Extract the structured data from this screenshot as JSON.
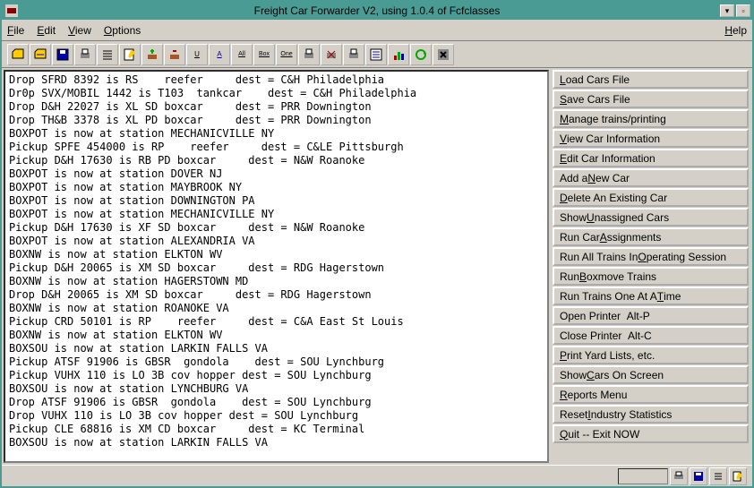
{
  "window": {
    "title": "Freight Car Forwarder V2, using 1.0.4 of Fcfclasses"
  },
  "menu": {
    "file": "File",
    "edit": "Edit",
    "view": "View",
    "options": "Options",
    "help": "Help"
  },
  "toolbar_icons": [
    "open",
    "open2",
    "save",
    "print",
    "list",
    "edit",
    "add",
    "del",
    "unasg",
    "asg",
    "all",
    "box",
    "one",
    "print2",
    "close",
    "print3",
    "list2",
    "stats",
    "quit",
    "x"
  ],
  "log": [
    "Drop SFRD 8392 is RS    reefer     dest = C&H Philadelphia",
    "Dr0p SVX/MOBIL 1442 is T103  tankcar    dest = C&H Philadelphia",
    "Drop D&H 22027 is XL SD boxcar     dest = PRR Downington",
    "Drop TH&B 3378 is XL PD boxcar     dest = PRR Downington",
    "BOXPOT is now at station MECHANICVILLE NY",
    "Pickup SPFE 454000 is RP    reefer     dest = C&LE Pittsburgh",
    "Pickup D&H 17630 is RB PD boxcar     dest = N&W Roanoke",
    "BOXPOT is now at station DOVER NJ",
    "BOXPOT is now at station MAYBROOK NY",
    "BOXPOT is now at station DOWNINGTON PA",
    "BOXPOT is now at station MECHANICVILLE NY",
    "Pickup D&H 17630 is XF SD boxcar     dest = N&W Roanoke",
    "BOXPOT is now at station ALEXANDRIA VA",
    "BOXNW is now at station ELKTON WV",
    "Pickup D&H 20065 is XM SD boxcar     dest = RDG Hagerstown",
    "BOXNW is now at station HAGERSTOWN MD",
    "Drop D&H 20065 is XM SD boxcar     dest = RDG Hagerstown",
    "BOXNW is now at station ROANOKE VA",
    "Pickup CRD 50101 is RP    reefer     dest = C&A East St Louis",
    "BOXNW is now at station ELKTON WV",
    "BOXSOU is now at station LARKIN FALLS VA",
    "Pickup ATSF 91906 is GBSR  gondola    dest = SOU Lynchburg",
    "Pickup VUHX 110 is LO 3B cov hopper dest = SOU Lynchburg",
    "BOXSOU is now at station LYNCHBURG VA",
    "Drop ATSF 91906 is GBSR  gondola    dest = SOU Lynchburg",
    "Drop VUHX 110 is LO 3B cov hopper dest = SOU Lynchburg",
    "Pickup CLE 68816 is XM CD boxcar     dest = KC Terminal",
    "BOXSOU is now at station LARKIN FALLS VA"
  ],
  "side": {
    "load": "Load Cars File",
    "save": "Save Cars File",
    "manage": "Manage trains/printing",
    "viewcar": "View Car Information",
    "editcar": "Edit Car Information",
    "addcar": "Add a New Car",
    "delcar": "Delete An Existing Car",
    "unasg": "Show Unassigned Cars",
    "runasg": "Run Car Assignments",
    "runall": "Run All Trains In Operating Session",
    "runbox": "Run Boxmove Trains",
    "runone": "Run Trains One At A Time",
    "openprn": "Open Printer  Alt-P",
    "closeprn": "Close Printer  Alt-C",
    "printyard": "Print Yard Lists, etc.",
    "showcars": "Show Cars On Screen",
    "reports": "Reports Menu",
    "reset": "Reset Industry Statistics",
    "quit": "Quit -- Exit NOW"
  }
}
